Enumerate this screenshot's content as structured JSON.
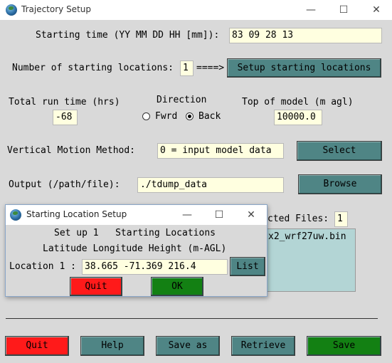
{
  "window": {
    "title": "Trajectory Setup",
    "controls": {
      "minimize": "—",
      "maximize": "☐",
      "close": "✕"
    }
  },
  "start_time": {
    "label": "Starting time (YY MM DD HH [mm]):",
    "value": "83 09 28 13"
  },
  "num_locations": {
    "label": "Number of starting locations:",
    "value": "1",
    "arrow": "====>",
    "button": "Setup starting locations"
  },
  "run_time": {
    "label": "Total run time (hrs)",
    "value": "-68"
  },
  "direction": {
    "label": "Direction",
    "options": [
      {
        "label": "Fwrd",
        "selected": false
      },
      {
        "label": "Back",
        "selected": true
      }
    ]
  },
  "top_model": {
    "label": "Top of model (m agl)",
    "value": "10000.0"
  },
  "vertical_motion": {
    "label": "Vertical Motion Method:",
    "value": "0 = input model data",
    "button": "Select"
  },
  "output": {
    "label": "Output (/path/file):",
    "value": "./tdump_data",
    "button": "Browse"
  },
  "selected_files": {
    "label": "cted Files:",
    "value": "1",
    "list": [
      "x2_wrf27uw.bin"
    ]
  },
  "bottom_buttons": {
    "quit": "Quit",
    "help": "Help",
    "save_as": "Save as",
    "retrieve": "Retrieve",
    "save": "Save"
  },
  "dialog": {
    "title": "Starting Location Setup",
    "controls": {
      "minimize": "—",
      "maximize": "☐",
      "close": "✕"
    },
    "header_line1": "Set up 1   Starting Locations",
    "header_line2": "Latitude Longitude Height (m-AGL)",
    "location_label": "Location 1 :",
    "location_value": "38.665 -71.369 216.4",
    "list_button": "List",
    "quit_button": "Quit",
    "ok_button": "OK"
  },
  "colors": {
    "background": "#d9d9d9",
    "field": "#ffffe0",
    "teal_button": "#4f8585",
    "quit_red": "#ff1a1a",
    "ok_green": "#138013",
    "listbox": "#b3d5d5"
  }
}
